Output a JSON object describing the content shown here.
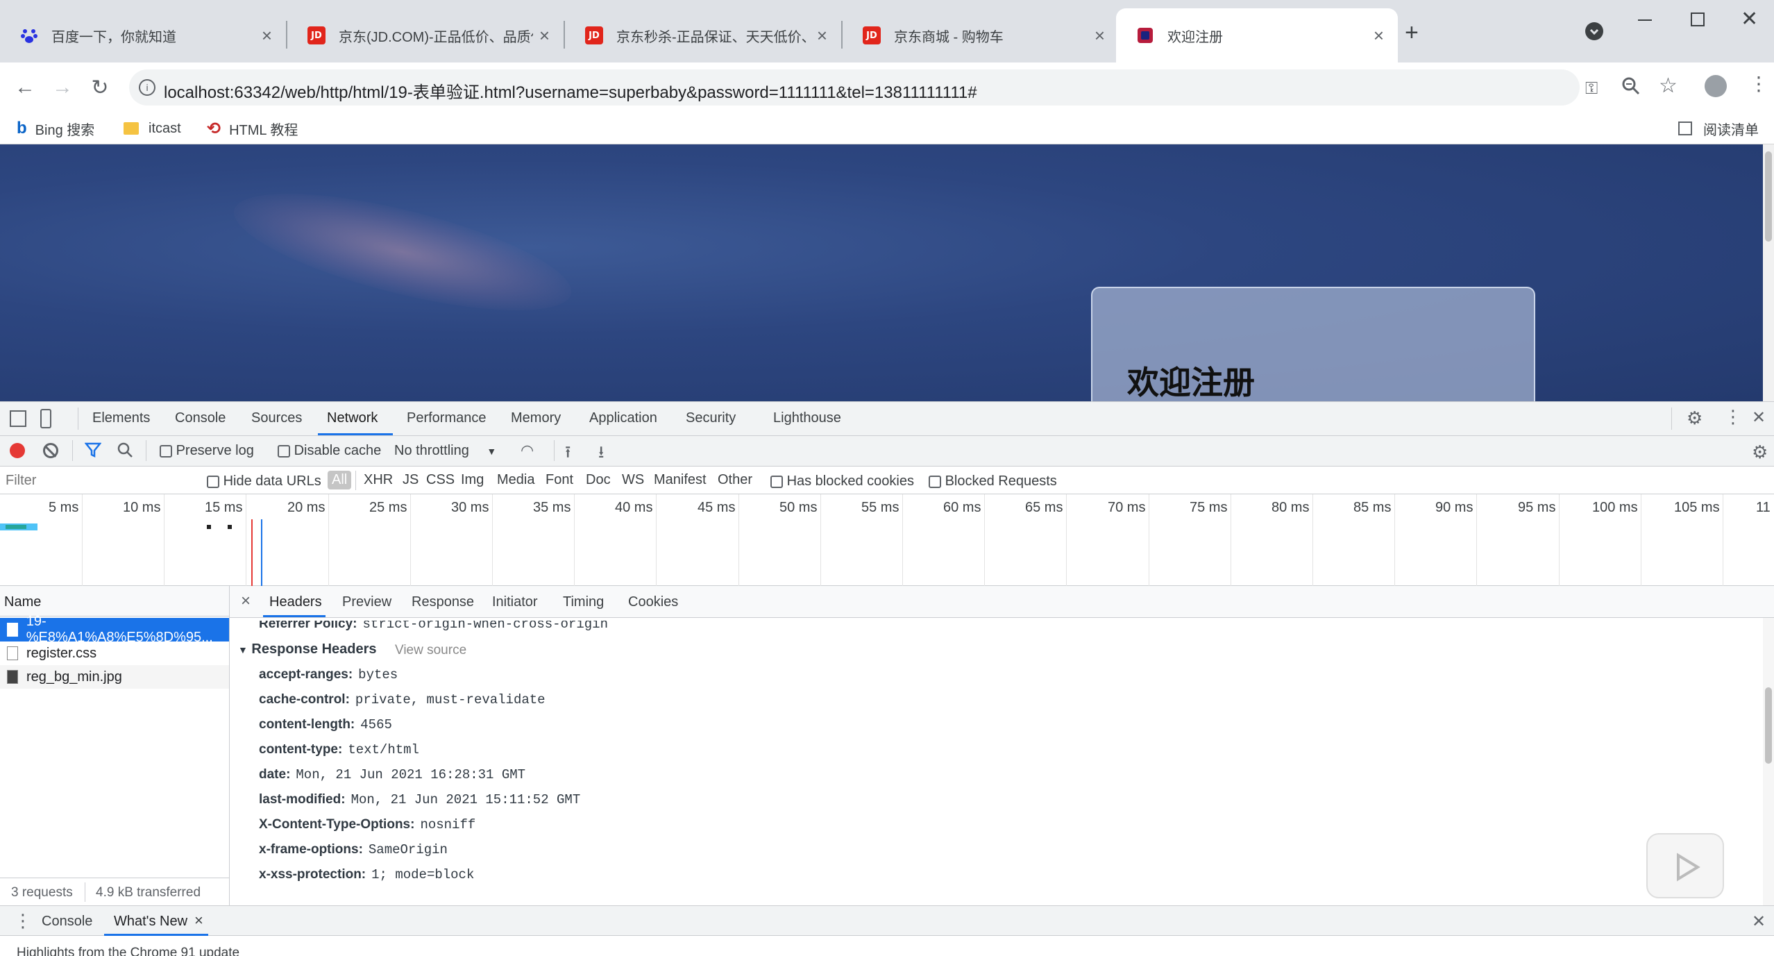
{
  "browser": {
    "tabs": [
      {
        "title": "百度一下，你就知道",
        "icon": "baidu-paw-icon"
      },
      {
        "title": "京东(JD.COM)-正品低价、品质保障",
        "icon": "jd-logo-icon"
      },
      {
        "title": "京东秒杀-正品保证、天天低价、",
        "icon": "jd-logo-icon"
      },
      {
        "title": "京东商城 - 购物车",
        "icon": "jd-logo-icon"
      },
      {
        "title": "欢迎注册",
        "icon": "site-logo-icon",
        "active": true
      }
    ],
    "jd_label": "JD",
    "url": "localhost:63342/web/http/html/19-表单验证.html?username=superbaby&password=1111111&tel=13811111111#",
    "bookmarks": [
      {
        "label": "Bing 搜索"
      },
      {
        "label": "itcast"
      },
      {
        "label": "HTML 教程"
      }
    ],
    "reading_list": "阅读清单"
  },
  "page": {
    "register_title": "欢迎注册"
  },
  "devtools": {
    "tabs": [
      "Elements",
      "Console",
      "Sources",
      "Network",
      "Performance",
      "Memory",
      "Application",
      "Security",
      "Lighthouse"
    ],
    "active_tab": "Network",
    "toolbar": {
      "preserve_log": "Preserve log",
      "disable_cache": "Disable cache",
      "throttling": "No throttling"
    },
    "filter": {
      "placeholder": "Filter",
      "hide_data_urls": "Hide data URLs",
      "types": [
        "All",
        "XHR",
        "JS",
        "CSS",
        "Img",
        "Media",
        "Font",
        "Doc",
        "WS",
        "Manifest",
        "Other"
      ],
      "has_blocked_cookies": "Has blocked cookies",
      "blocked_requests": "Blocked Requests"
    },
    "timeline_ticks": [
      "5 ms",
      "10 ms",
      "15 ms",
      "20 ms",
      "25 ms",
      "30 ms",
      "35 ms",
      "40 ms",
      "45 ms",
      "50 ms",
      "55 ms",
      "60 ms",
      "65 ms",
      "70 ms",
      "75 ms",
      "80 ms",
      "85 ms",
      "90 ms",
      "95 ms",
      "100 ms",
      "105 ms",
      "11"
    ],
    "requests": {
      "header": "Name",
      "items": [
        {
          "name": "19-%E8%A1%A8%E5%8D%95..."
        },
        {
          "name": "register.css"
        },
        {
          "name": "reg_bg_min.jpg"
        }
      ],
      "count": "3 requests",
      "transferred": "4.9 kB transferred"
    },
    "detail": {
      "tabs": [
        "Headers",
        "Preview",
        "Response",
        "Initiator",
        "Timing",
        "Cookies"
      ],
      "referrer_key": "Referrer Policy:",
      "referrer_value": "strict-origin-when-cross-origin",
      "section_title": "Response Headers",
      "view_source": "View source",
      "headers": [
        {
          "key": "accept-ranges:",
          "value": "bytes"
        },
        {
          "key": "cache-control:",
          "value": "private, must-revalidate"
        },
        {
          "key": "content-length:",
          "value": "4565"
        },
        {
          "key": "content-type:",
          "value": "text/html"
        },
        {
          "key": "date:",
          "value": "Mon, 21 Jun 2021 16:28:31 GMT"
        },
        {
          "key": "last-modified:",
          "value": "Mon, 21 Jun 2021 15:11:52 GMT"
        },
        {
          "key": "X-Content-Type-Options:",
          "value": "nosniff"
        },
        {
          "key": "x-frame-options:",
          "value": "SameOrigin"
        },
        {
          "key": "x-xss-protection:",
          "value": "1; mode=block"
        }
      ]
    },
    "drawer": {
      "tabs": [
        "Console",
        "What's New"
      ],
      "body": "Highlights from the Chrome 91 update"
    }
  }
}
